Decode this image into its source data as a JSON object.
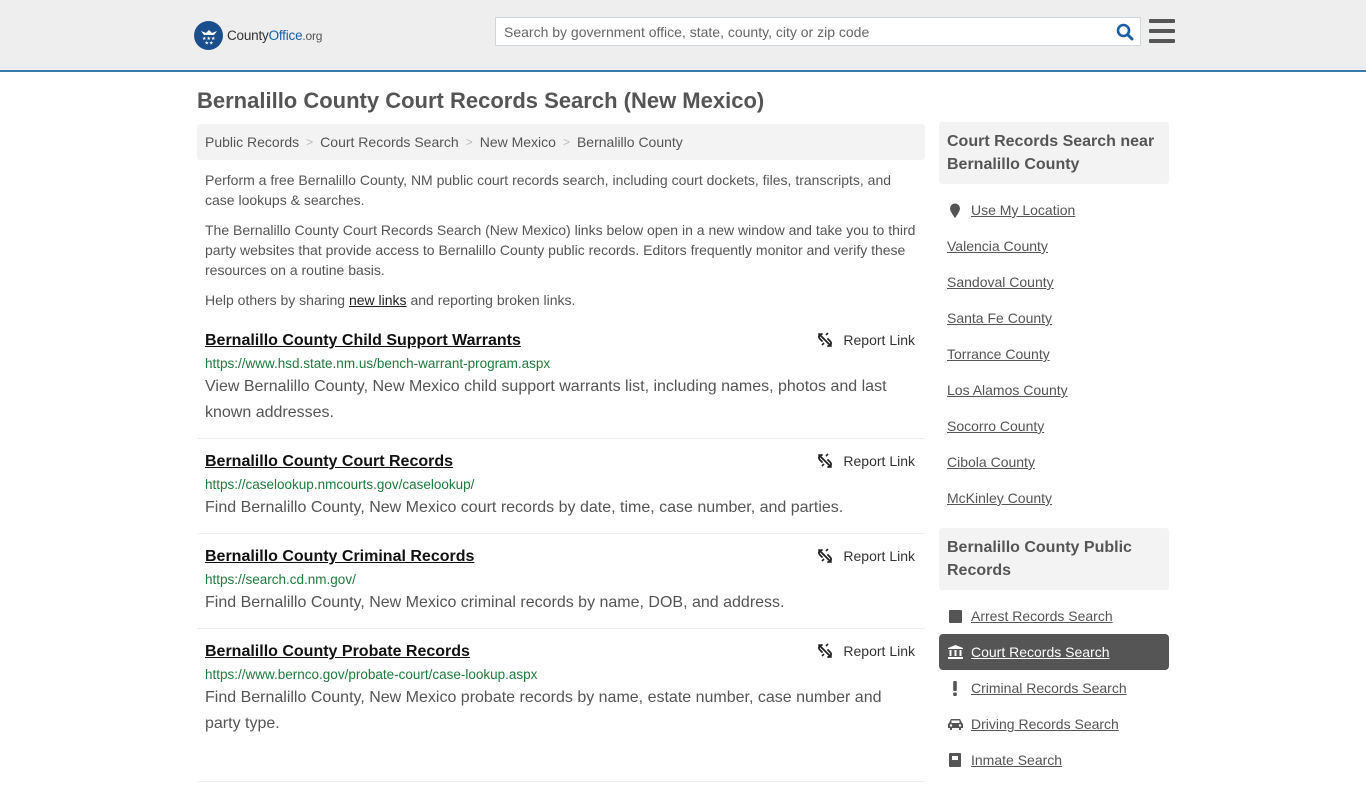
{
  "header": {
    "logo": {
      "prefix": "County",
      "brand": "Office",
      "tld": ".org"
    },
    "search_placeholder": "Search by government office, state, county, city or zip code",
    "search_value": "",
    "accent_color": "#3b7bab"
  },
  "page": {
    "title": "Bernalillo County Court Records Search (New Mexico)",
    "breadcrumb": [
      "Public Records",
      "Court Records Search",
      "New Mexico",
      "Bernalillo County"
    ],
    "intro": {
      "p1": "Perform a free Bernalillo County, NM public court records search, including court dockets, files, transcripts, and case lookups & searches.",
      "p2": "The Bernalillo County Court Records Search (New Mexico) links below open in a new window and take you to third party websites that provide access to Bernalillo County public records. Editors frequently monitor and verify these resources on a routine basis.",
      "p3_before": "Help others by sharing ",
      "p3_link": "new links",
      "p3_after": " and reporting broken links."
    }
  },
  "records": [
    {
      "title": "Bernalillo County Child Support Warrants",
      "url": "https://www.hsd.state.nm.us/bench-warrant-program.aspx",
      "description": "View Bernalillo County, New Mexico child support warrants list, including names, photos and last known addresses.",
      "report_label": "Report Link"
    },
    {
      "title": "Bernalillo County Court Records",
      "url": "https://caselookup.nmcourts.gov/caselookup/",
      "description": "Find Bernalillo County, New Mexico court records by date, time, case number, and parties.",
      "report_label": "Report Link"
    },
    {
      "title": "Bernalillo County Criminal Records",
      "url": "https://search.cd.nm.gov/",
      "description": "Find Bernalillo County, New Mexico criminal records by name, DOB, and address.",
      "report_label": "Report Link"
    },
    {
      "title": "Bernalillo County Probate Records",
      "url": "https://www.bernco.gov/probate-court/case-lookup.aspx",
      "description": "Find Bernalillo County, New Mexico probate records by name, estate number, case number and party type.",
      "report_label": "Report Link"
    }
  ],
  "sidebar": {
    "nearby": {
      "heading": "Court Records Search near Bernalillo County",
      "use_location": "Use My Location",
      "items": [
        "Valencia County",
        "Sandoval County",
        "Santa Fe County",
        "Torrance County",
        "Los Alamos County",
        "Socorro County",
        "Cibola County",
        "McKinley County"
      ]
    },
    "public_records": {
      "heading": "Bernalillo County Public Records",
      "items": [
        {
          "label": "Arrest Records Search",
          "icon": "square-icon",
          "active": false
        },
        {
          "label": "Court Records Search",
          "icon": "courthouse-icon",
          "active": true
        },
        {
          "label": "Criminal Records Search",
          "icon": "exclamation-icon",
          "active": false
        },
        {
          "label": "Driving Records Search",
          "icon": "car-icon",
          "active": false
        },
        {
          "label": "Inmate Search",
          "icon": "inmate-icon",
          "active": false
        }
      ]
    }
  }
}
